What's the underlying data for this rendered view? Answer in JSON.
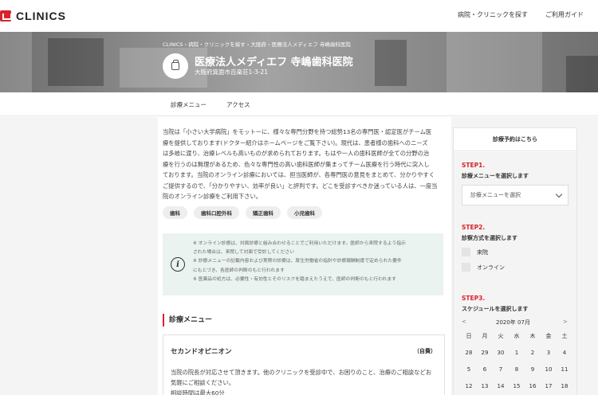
{
  "header": {
    "logo_text": "CLINICS",
    "nav": [
      "病院・クリニックを探す",
      "ご利用ガイド"
    ]
  },
  "hero": {
    "breadcrumb": "CLINICS › 病院・クリニックを探す › 大阪府 › 医療法人メディエフ 寺嶋歯科医院",
    "clinic_name": "医療法人メディエフ 寺嶋歯科医院",
    "address": "大阪府箕面市百楽荘1-3-21"
  },
  "tabs": [
    "診療メニュー",
    "アクセス"
  ],
  "intro_lines": [
    "当院は「小さい大学病院」をモットーに、様々な専門分野を持つ総勢13名の専門医・認定医がチーム医",
    "療を提供しております(ドクター紹介はホームページをご覧下さい)。現代は、患者様の歯科へのニーズ",
    "は多岐に渡り、治療レベルも高いものが求められております。もはや一人の歯科医師が全ての分野の治",
    "療を行うのは無理があるため、色々な専門性の高い歯科医師が集まってチーム医療を行う時代に突入し",
    "ております。当院のオンライン診療においては、担当医師が、各専門医の意見をまとめて、分かりやすく",
    "ご提供するので、「分かりやすい、効率が良い」と評判です。どこを受診すべきか迷っている人は、一度当",
    "院のオンライン診療をご利用下さい。"
  ],
  "tags": [
    "歯科",
    "歯科口腔外科",
    "矯正歯科",
    "小児歯科"
  ],
  "notice": {
    "icon": "info-icon",
    "lines": [
      "※ オンライン診療は、対面診療と組み合わせることでご利用いただけます。医師から来院するよう指示",
      "された場合は、来院して対面で受診してください",
      "※ 診療メニューの記載内容および実際の診療は、厚生労働省の指針や診療報酬制度で定められた要件",
      "にもとづき、各医師の判断のもと行われます",
      "※ 医薬品の処方は、必要性・有効性とそのリスクを踏まえたうえで、医師の判断のもと行われます"
    ]
  },
  "menu": {
    "heading": "診療メニュー",
    "card_title": "セカンドオピニオン",
    "card_price": "（自費）",
    "card_desc": [
      "当院の院長が対応させて頂きます。他のクリニックを受診中で、お困りのこと、治療のご相談などお",
      "気軽にご相談ください。",
      "相談時間は最大60分"
    ]
  },
  "sidebar": {
    "header": "診療予約はこちら",
    "step1_label": "STEP1.",
    "step1_title": "診療メニューを選択します",
    "select_placeholder": "診療メニューを選択",
    "step2_label": "STEP2.",
    "step2_title": "診察方式を選択します",
    "options": [
      "来院",
      "オンライン"
    ],
    "step3_label": "STEP3.",
    "step3_title": "スケジュールを選択します",
    "calendar": {
      "prev": "<",
      "next": ">",
      "month": "2020年 07月",
      "weekdays": [
        "日",
        "月",
        "火",
        "水",
        "木",
        "金",
        "土"
      ],
      "days": [
        "28",
        "29",
        "30",
        "1",
        "2",
        "3",
        "4",
        "5",
        "6",
        "7",
        "8",
        "9",
        "10",
        "11",
        "12",
        "13",
        "14",
        "15",
        "16",
        "17",
        "18"
      ]
    }
  }
}
